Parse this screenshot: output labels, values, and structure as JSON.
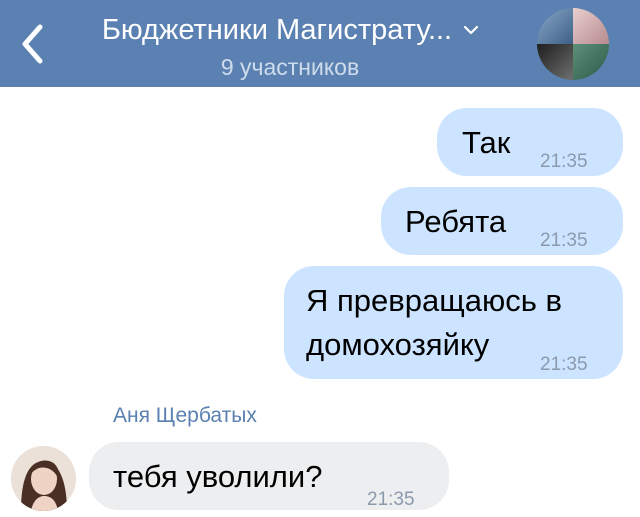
{
  "header": {
    "title": "Бюджетники Магистрату...",
    "subtitle": "9 участников",
    "icons": [
      "back-chevron-icon",
      "dropdown-chevron-icon",
      "group-avatar"
    ]
  },
  "messages": [
    {
      "text": "Так",
      "time": "21:35",
      "outgoing": true
    },
    {
      "text": "Ребята",
      "time": "21:35",
      "outgoing": true
    },
    {
      "line1": "Я превращаюсь в",
      "line2": "домохозяйку",
      "time": "21:35",
      "outgoing": true
    },
    {
      "sender": "Аня Щербатых",
      "text": "тебя уволили?",
      "time": "21:35",
      "outgoing": false
    }
  ],
  "colors": {
    "header_bg": "#5a81b1",
    "outgoing_bubble": "#cce4ff",
    "incoming_bubble": "#edeef0",
    "sender_name": "#5a81b1"
  }
}
